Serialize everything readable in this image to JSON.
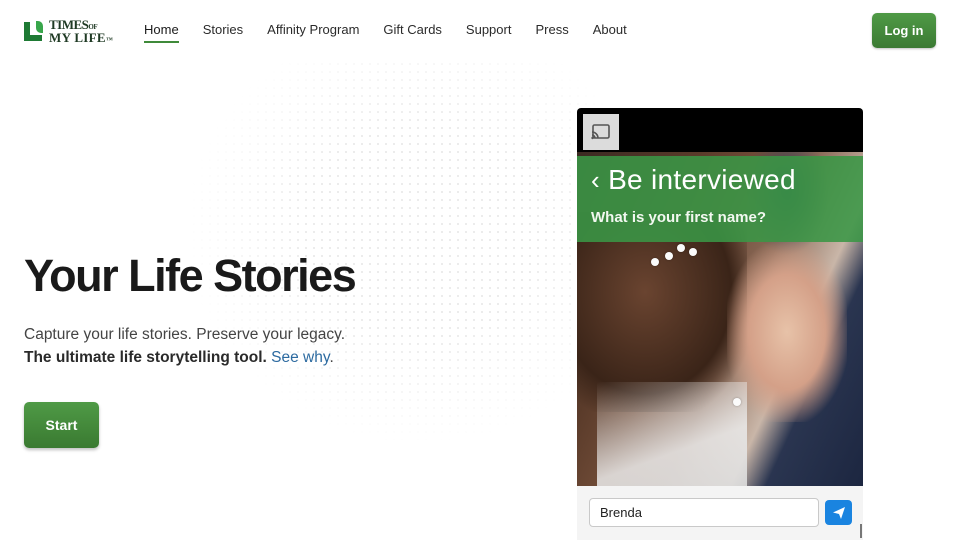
{
  "logo": {
    "line1": "TIMES",
    "line1_suffix": "OF",
    "line2": "MY LIFE",
    "line2_suffix": "™"
  },
  "nav": {
    "items": [
      {
        "label": "Home",
        "active": true
      },
      {
        "label": "Stories"
      },
      {
        "label": "Affinity Program"
      },
      {
        "label": "Gift Cards"
      },
      {
        "label": "Support"
      },
      {
        "label": "Press"
      },
      {
        "label": "About"
      }
    ]
  },
  "header": {
    "login_label": "Log in"
  },
  "hero": {
    "title": "Your Life Stories",
    "subtitle": "Capture your life stories. Preserve your legacy.",
    "tagline": "The ultimate life storytelling tool.",
    "link": "See why",
    "link_suffix": ".",
    "start_label": "Start"
  },
  "video": {
    "cast_icon": "cast-icon",
    "interview_title": "Be interviewed",
    "back_icon": "chevron-left-icon",
    "question": "What is your first name?",
    "answer_value": "Brenda",
    "send_icon": "send-icon"
  },
  "colors": {
    "brand_green": "#3f8a3a",
    "link_blue": "#2c6aa0",
    "send_blue": "#1a84e0"
  }
}
